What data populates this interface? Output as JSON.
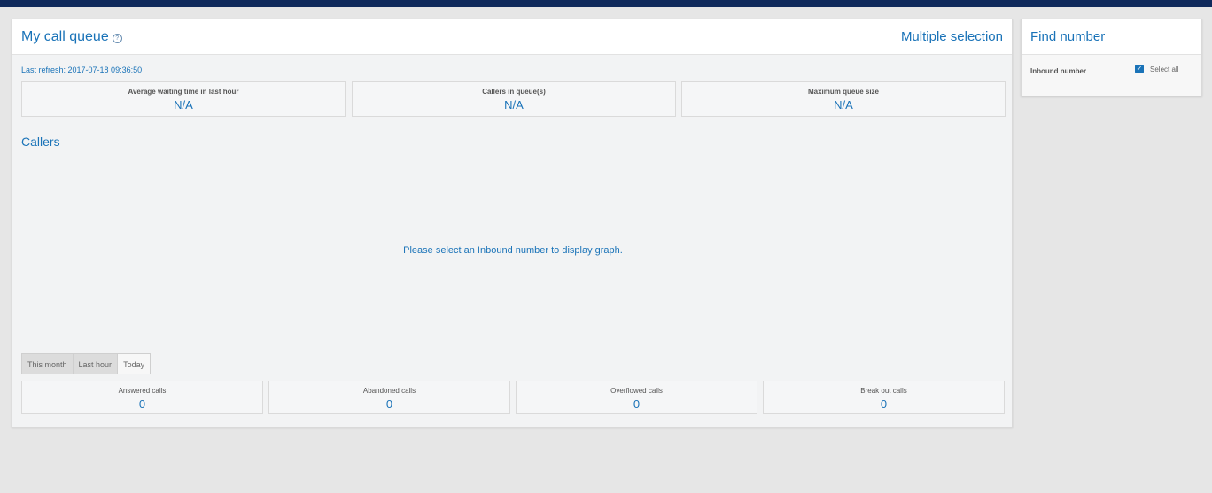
{
  "header": {
    "title": "My call queue",
    "multiple_selection": "Multiple selection"
  },
  "last_refresh": "Last refresh: 2017-07-18 09:36:50",
  "queue_stats": [
    {
      "label": "Average waiting time in last hour",
      "value": "N/A"
    },
    {
      "label": "Callers in queue(s)",
      "value": "N/A"
    },
    {
      "label": "Maximum queue size",
      "value": "N/A"
    }
  ],
  "callers": {
    "title": "Callers",
    "graph_message": "Please select an Inbound number to display graph."
  },
  "period_tabs": {
    "items": [
      "This month",
      "Last hour",
      "Today"
    ],
    "active": "Today"
  },
  "call_stats": [
    {
      "label": "Answered calls",
      "value": "0"
    },
    {
      "label": "Abandoned calls",
      "value": "0"
    },
    {
      "label": "Overflowed calls",
      "value": "0"
    },
    {
      "label": "Break out calls",
      "value": "0"
    }
  ],
  "find_number": {
    "title": "Find number",
    "inbound_label": "Inbound number",
    "select_all_label": "Select all",
    "select_all_checked": true
  },
  "colors": {
    "accent": "#1a73b8",
    "top_bar": "#102a5c",
    "background": "#e6e6e6"
  },
  "icons": {
    "help": "help-circle-icon",
    "checkbox": "checkbox-checked-icon"
  }
}
